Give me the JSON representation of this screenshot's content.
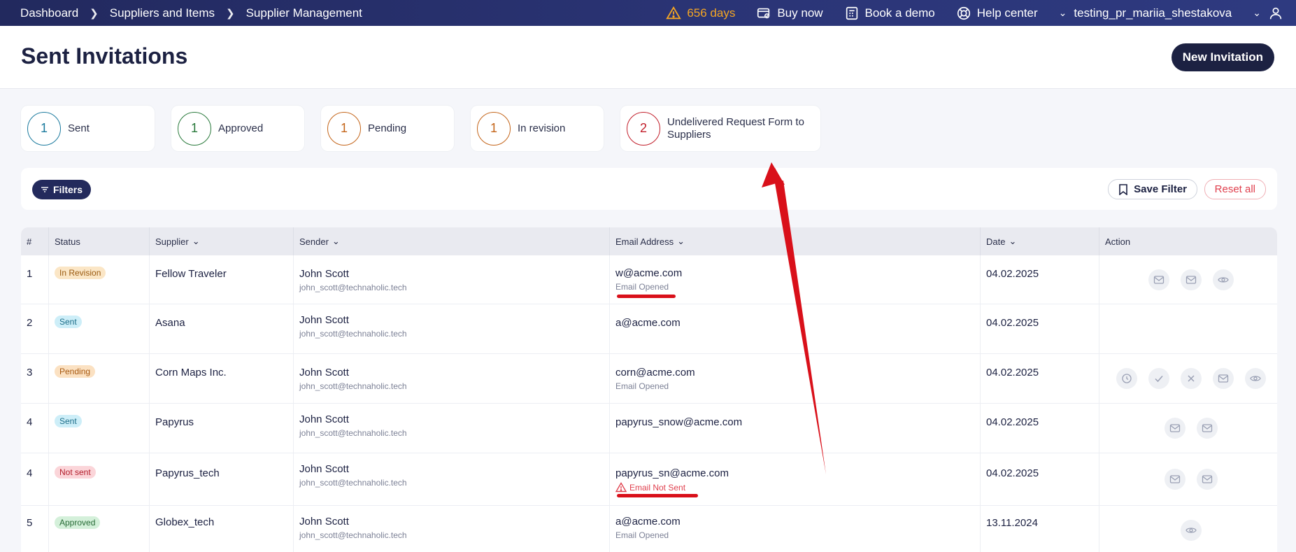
{
  "topbar": {
    "breadcrumbs": [
      "Dashboard",
      "Suppliers and Items",
      "Supplier Management"
    ],
    "days": "656 days",
    "buy_now": "Buy now",
    "book_demo": "Book a demo",
    "help_center": "Help center",
    "username": "testing_pr_mariia_shestakova"
  },
  "header": {
    "title": "Sent Invitations",
    "new_button": "New Invitation"
  },
  "stats": [
    {
      "count": "1",
      "label": "Sent",
      "color": "#1b7a9e"
    },
    {
      "count": "1",
      "label": "Approved",
      "color": "#2a7a3c"
    },
    {
      "count": "1",
      "label": "Pending",
      "color": "#c4651a"
    },
    {
      "count": "1",
      "label": "In revision",
      "color": "#c4651a"
    },
    {
      "count": "2",
      "label": "Undelivered Request Form to Suppliers",
      "color": "#c21f2b"
    }
  ],
  "filterbar": {
    "filters": "Filters",
    "save_filter": "Save Filter",
    "reset_all": "Reset all"
  },
  "table": {
    "headers": [
      "#",
      "Status",
      "Supplier",
      "Sender",
      "Email Address",
      "Date",
      "Action"
    ],
    "rows": [
      {
        "num": "1",
        "status": "In Revision",
        "supplier": "Fellow Traveler",
        "sender": "John Scott",
        "sender_email": "john_scott@technaholic.tech",
        "email": "w@acme.com",
        "email_status": "Email Opened",
        "date": "04.02.2025"
      },
      {
        "num": "2",
        "status": "Sent",
        "supplier": "Asana",
        "sender": "John Scott",
        "sender_email": "john_scott@technaholic.tech",
        "email": "a@acme.com",
        "email_status": "",
        "date": "04.02.2025"
      },
      {
        "num": "3",
        "status": "Pending",
        "supplier": "Corn Maps Inc.",
        "sender": "John Scott",
        "sender_email": "john_scott@technaholic.tech",
        "email": "corn@acme.com",
        "email_status": "Email Opened",
        "date": "04.02.2025"
      },
      {
        "num": "4",
        "status": "Sent",
        "supplier": "Papyrus",
        "sender": "John Scott",
        "sender_email": "john_scott@technaholic.tech",
        "email": "papyrus_snow@acme.com",
        "email_status": "",
        "date": "04.02.2025"
      },
      {
        "num": "4",
        "status": "Not sent",
        "supplier": "Papyrus_tech",
        "sender": "John Scott",
        "sender_email": "john_scott@technaholic.tech",
        "email": "papyrus_sn@acme.com",
        "email_status": "Email Not Sent",
        "date": "04.02.2025"
      },
      {
        "num": "5",
        "status": "Approved",
        "supplier": "Globex_tech",
        "sender": "John Scott",
        "sender_email": "john_scott@technaholic.tech",
        "email": "a@acme.com",
        "email_status": "Email Opened",
        "date": "13.11.2024"
      }
    ]
  },
  "annotation_color": "#d9101a"
}
